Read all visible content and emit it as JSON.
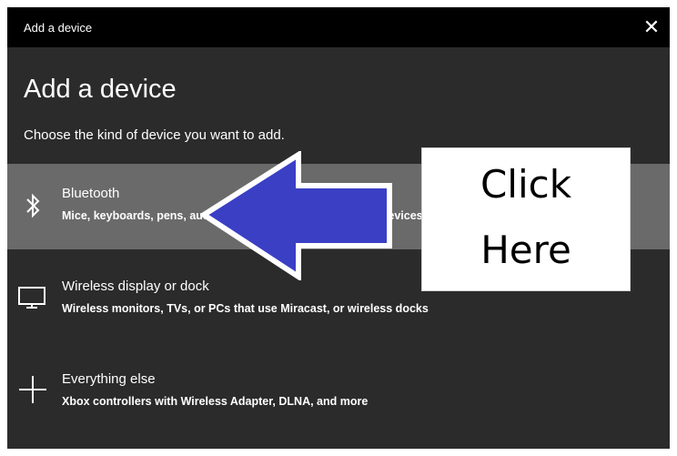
{
  "window": {
    "title": "Add a device",
    "close_glyph": "✕"
  },
  "main": {
    "heading": "Add a device",
    "subheading": "Choose the kind of device you want to add."
  },
  "options": [
    {
      "icon": "bluetooth-icon",
      "label": "Bluetooth",
      "description": "Mice, keyboards, pens, audio and other kinds of Bluetooth devices",
      "selected": true
    },
    {
      "icon": "monitor-icon",
      "label": "Wireless display or dock",
      "description": "Wireless monitors, TVs, or PCs that use Miracast, or wireless docks",
      "selected": false
    },
    {
      "icon": "plus-icon",
      "label": "Everything else",
      "description": "Xbox controllers with Wireless Adapter, DLNA, and more",
      "selected": false
    }
  ],
  "annotation": {
    "line1": "Click",
    "line2": "Here",
    "arrow_color": "#3a3fc4"
  }
}
